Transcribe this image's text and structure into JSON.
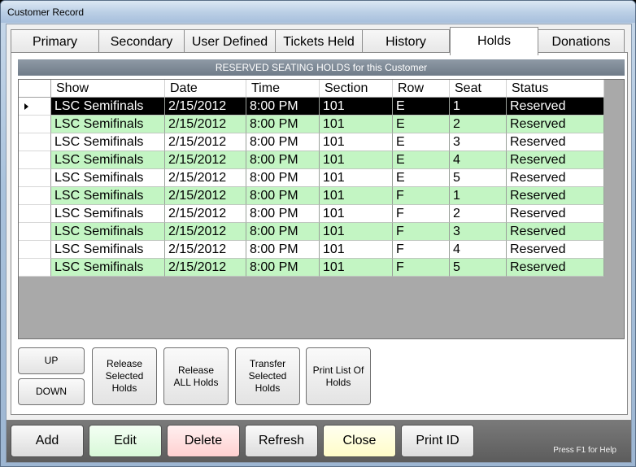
{
  "window": {
    "title": "Customer Record"
  },
  "tabs": [
    {
      "label": "Primary"
    },
    {
      "label": "Secondary"
    },
    {
      "label": "User Defined"
    },
    {
      "label": "Tickets Held"
    },
    {
      "label": "History"
    },
    {
      "label": "Holds"
    },
    {
      "label": "Donations"
    }
  ],
  "active_tab": "Holds",
  "grid": {
    "caption": "RESERVED SEATING HOLDS for this Customer",
    "columns": [
      "Show",
      "Date",
      "Time",
      "Section",
      "Row",
      "Seat",
      "Status"
    ],
    "rows": [
      [
        "LSC Semifinals",
        "2/15/2012",
        "8:00 PM",
        "101",
        "E",
        "1",
        "Reserved"
      ],
      [
        "LSC Semifinals",
        "2/15/2012",
        "8:00 PM",
        "101",
        "E",
        "2",
        "Reserved"
      ],
      [
        "LSC Semifinals",
        "2/15/2012",
        "8:00 PM",
        "101",
        "E",
        "3",
        "Reserved"
      ],
      [
        "LSC Semifinals",
        "2/15/2012",
        "8:00 PM",
        "101",
        "E",
        "4",
        "Reserved"
      ],
      [
        "LSC Semifinals",
        "2/15/2012",
        "8:00 PM",
        "101",
        "E",
        "5",
        "Reserved"
      ],
      [
        "LSC Semifinals",
        "2/15/2012",
        "8:00 PM",
        "101",
        "F",
        "1",
        "Reserved"
      ],
      [
        "LSC Semifinals",
        "2/15/2012",
        "8:00 PM",
        "101",
        "F",
        "2",
        "Reserved"
      ],
      [
        "LSC Semifinals",
        "2/15/2012",
        "8:00 PM",
        "101",
        "F",
        "3",
        "Reserved"
      ],
      [
        "LSC Semifinals",
        "2/15/2012",
        "8:00 PM",
        "101",
        "F",
        "4",
        "Reserved"
      ],
      [
        "LSC Semifinals",
        "2/15/2012",
        "8:00 PM",
        "101",
        "F",
        "5",
        "Reserved"
      ]
    ],
    "selected_row": 0
  },
  "actions": {
    "up": "UP",
    "down": "DOWN",
    "release_selected": "Release\nSelected\nHolds",
    "release_all": "Release\nALL Holds",
    "transfer_selected": "Transfer\nSelected\nHolds",
    "print_list": "Print List Of\nHolds"
  },
  "bottom_buttons": {
    "add": "Add",
    "edit": "Edit",
    "delete": "Delete",
    "refresh": "Refresh",
    "close": "Close",
    "print_id": "Print ID"
  },
  "help_text": "Press F1 for Help",
  "colors": {
    "row_alt": "#c3f5c3",
    "row_selected": "#000000",
    "edit_button": "#d8f8d8",
    "delete_button": "#ffd0d0",
    "close_button": "#fffcc8"
  }
}
